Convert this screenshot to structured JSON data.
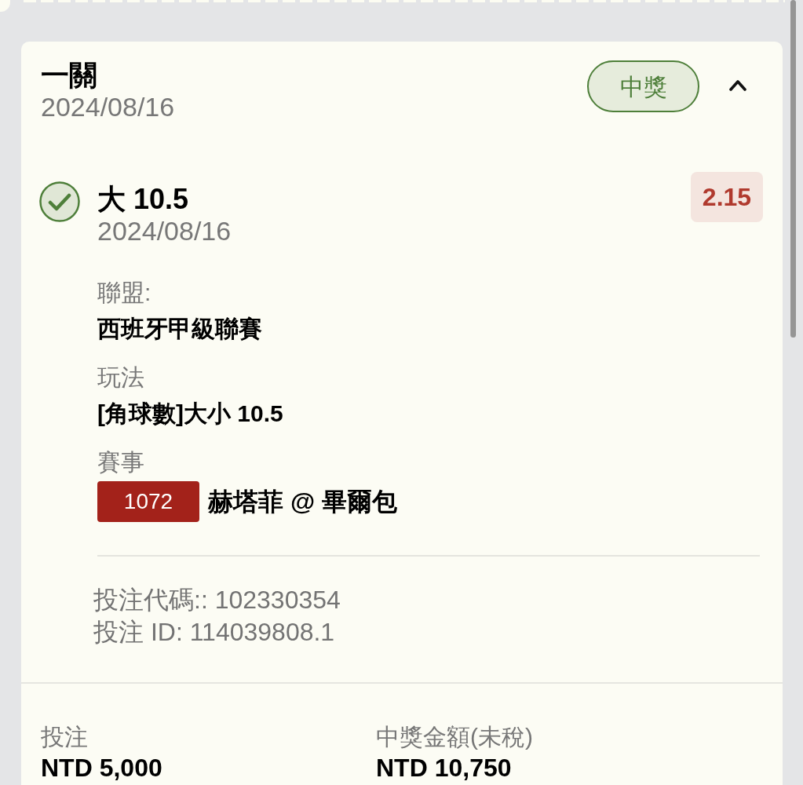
{
  "bet": {
    "title": "一關",
    "date": "2024/08/16",
    "status": {
      "label": "中獎",
      "kind": "won"
    },
    "expanded": true
  },
  "selections": [
    {
      "won": true,
      "pick": "大 10.5",
      "date": "2024/08/16",
      "odds": "2.15",
      "details": [
        {
          "kind": "text",
          "label": "聯盟:",
          "value": "西班牙甲級聯賽"
        },
        {
          "kind": "text",
          "label": "玩法",
          "value": "[角球數]大小 10.5"
        },
        {
          "kind": "match",
          "label": "賽事",
          "match_code": "1072",
          "value": "赫塔菲 @ 畢爾包"
        }
      ],
      "references": [
        "投注代碼:: 102330354",
        "投注 ID: 114039808.1"
      ]
    }
  ],
  "summary": [
    {
      "label": "投注",
      "value": "NTD 5,000"
    },
    {
      "label": "中獎金額(未稅)",
      "value": "NTD 10,750"
    }
  ]
}
